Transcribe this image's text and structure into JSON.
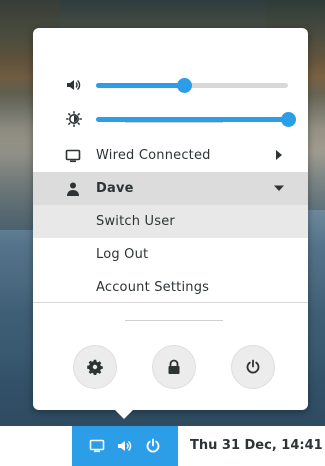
{
  "popover": {
    "sliders": [
      {
        "icon": "volume-icon",
        "value_fraction": 0.46
      },
      {
        "icon": "brightness-icon",
        "value_fraction": 1.0
      }
    ],
    "network": {
      "label": "Wired Connected",
      "icon": "monitor-icon"
    },
    "user": {
      "name": "Dave",
      "icon": "user-icon"
    },
    "user_menu": {
      "switch_user": "Switch User",
      "log_out": "Log Out",
      "account_settings": "Account Settings"
    },
    "actions": [
      "settings-icon",
      "lock-icon",
      "power-icon"
    ]
  },
  "panel": {
    "tray_icons": [
      "display-icon",
      "volume-icon",
      "power-icon"
    ],
    "clock": "Thu 31 Dec, 14:41",
    "accent": "#2c9ee8"
  }
}
